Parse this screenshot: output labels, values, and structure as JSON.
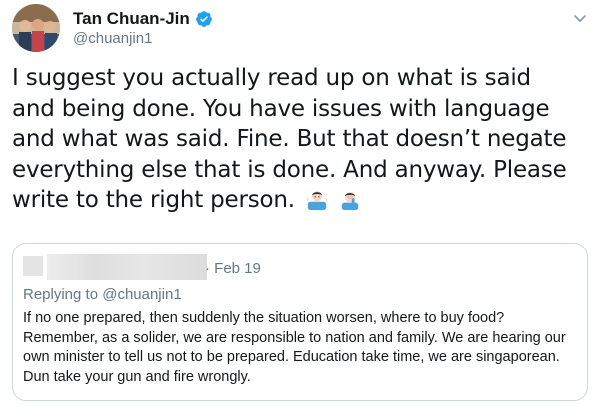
{
  "author": {
    "name": "Tan Chuan-Jin",
    "handle": "@chuanjin1"
  },
  "tweet": {
    "text": "I suggest you actually read up on what is said and being done. You have issues with language and what was said. Fine. But that doesn’t negate everything else that is done. And anyway. Please write to the right person.",
    "emojis": [
      "man-shrugging-icon",
      "man-facepalming-icon"
    ]
  },
  "quoted_tweet": {
    "date": "· Feb 19",
    "replying_to": "Replying to @chuanjin1",
    "text": "If no one prepared, then suddenly the situation worsen, where to buy food? Remember, as a solider, we are responsible to nation and family. We are hearing our own minister to tell us not to be prepared. Education take time, we are singaporean. Dun take your gun and fire wrongly."
  },
  "colors": {
    "verified": "#1da1f2",
    "secondary_text": "#657786",
    "border": "#ccd6dd"
  }
}
